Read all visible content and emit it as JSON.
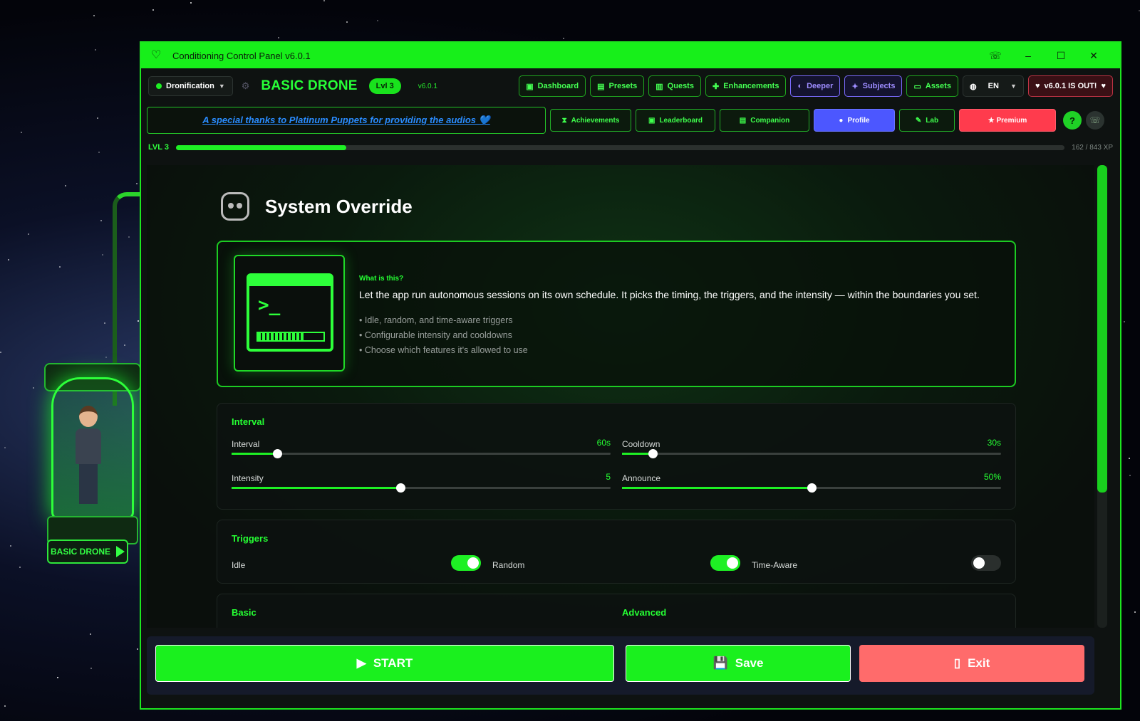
{
  "window": {
    "title": "Conditioning Control Panel v6.0.1"
  },
  "toolbar": {
    "mode": "Dronification",
    "rank": "BASIC DRONE",
    "level_pill": "Lvl 3",
    "version": "v6.0.1",
    "nav": [
      "Dashboard",
      "Presets",
      "Quests",
      "Enhancements",
      "Deeper",
      "Subjects",
      "Assets"
    ],
    "language": "EN",
    "update_label": "v6.0.1 IS OUT!"
  },
  "banner": {
    "thanks": "A special thanks to Platinum Puppets for providing the audios 💙"
  },
  "tabs": [
    "Achievements",
    "Leaderboard",
    "Companion",
    "Profile",
    "Lab",
    "★ Premium"
  ],
  "xp": {
    "level": "LVL 3",
    "text": "162 / 843 XP",
    "progress": 0.192
  },
  "pod": {
    "label": "BASIC DRONE"
  },
  "section": {
    "title": "System Override",
    "question": "What is this?",
    "description": "Let the app run autonomous sessions on its own schedule. It picks the timing, the triggers, and the intensity — within the boundaries you set.",
    "bullets": [
      "• Idle, random, and time-aware triggers",
      "• Configurable intensity and cooldowns",
      "• Choose which features it's allowed to use"
    ]
  },
  "interval_panel": {
    "title": "Interval",
    "sliders": [
      {
        "name": "Interval",
        "value": "60s",
        "fraction": 0.12
      },
      {
        "name": "Cooldown",
        "value": "30s",
        "fraction": 0.08
      },
      {
        "name": "Intensity",
        "value": "5",
        "fraction": 0.445
      },
      {
        "name": "Announce",
        "value": "50%",
        "fraction": 0.5
      }
    ]
  },
  "triggers_panel": {
    "title": "Triggers",
    "items": [
      {
        "name": "Idle",
        "on": true
      },
      {
        "name": "Random",
        "on": true
      },
      {
        "name": "Time-Aware",
        "on": false
      }
    ]
  },
  "lower_panel": {
    "basic": "Basic",
    "advanced": "Advanced"
  },
  "actions": {
    "start": "START",
    "save": "Save",
    "exit": "Exit"
  },
  "colors": {
    "accent": "#1ef024",
    "profile": "#4c57ff",
    "premium": "#ff3b4d",
    "exit": "#ff6b6b"
  }
}
